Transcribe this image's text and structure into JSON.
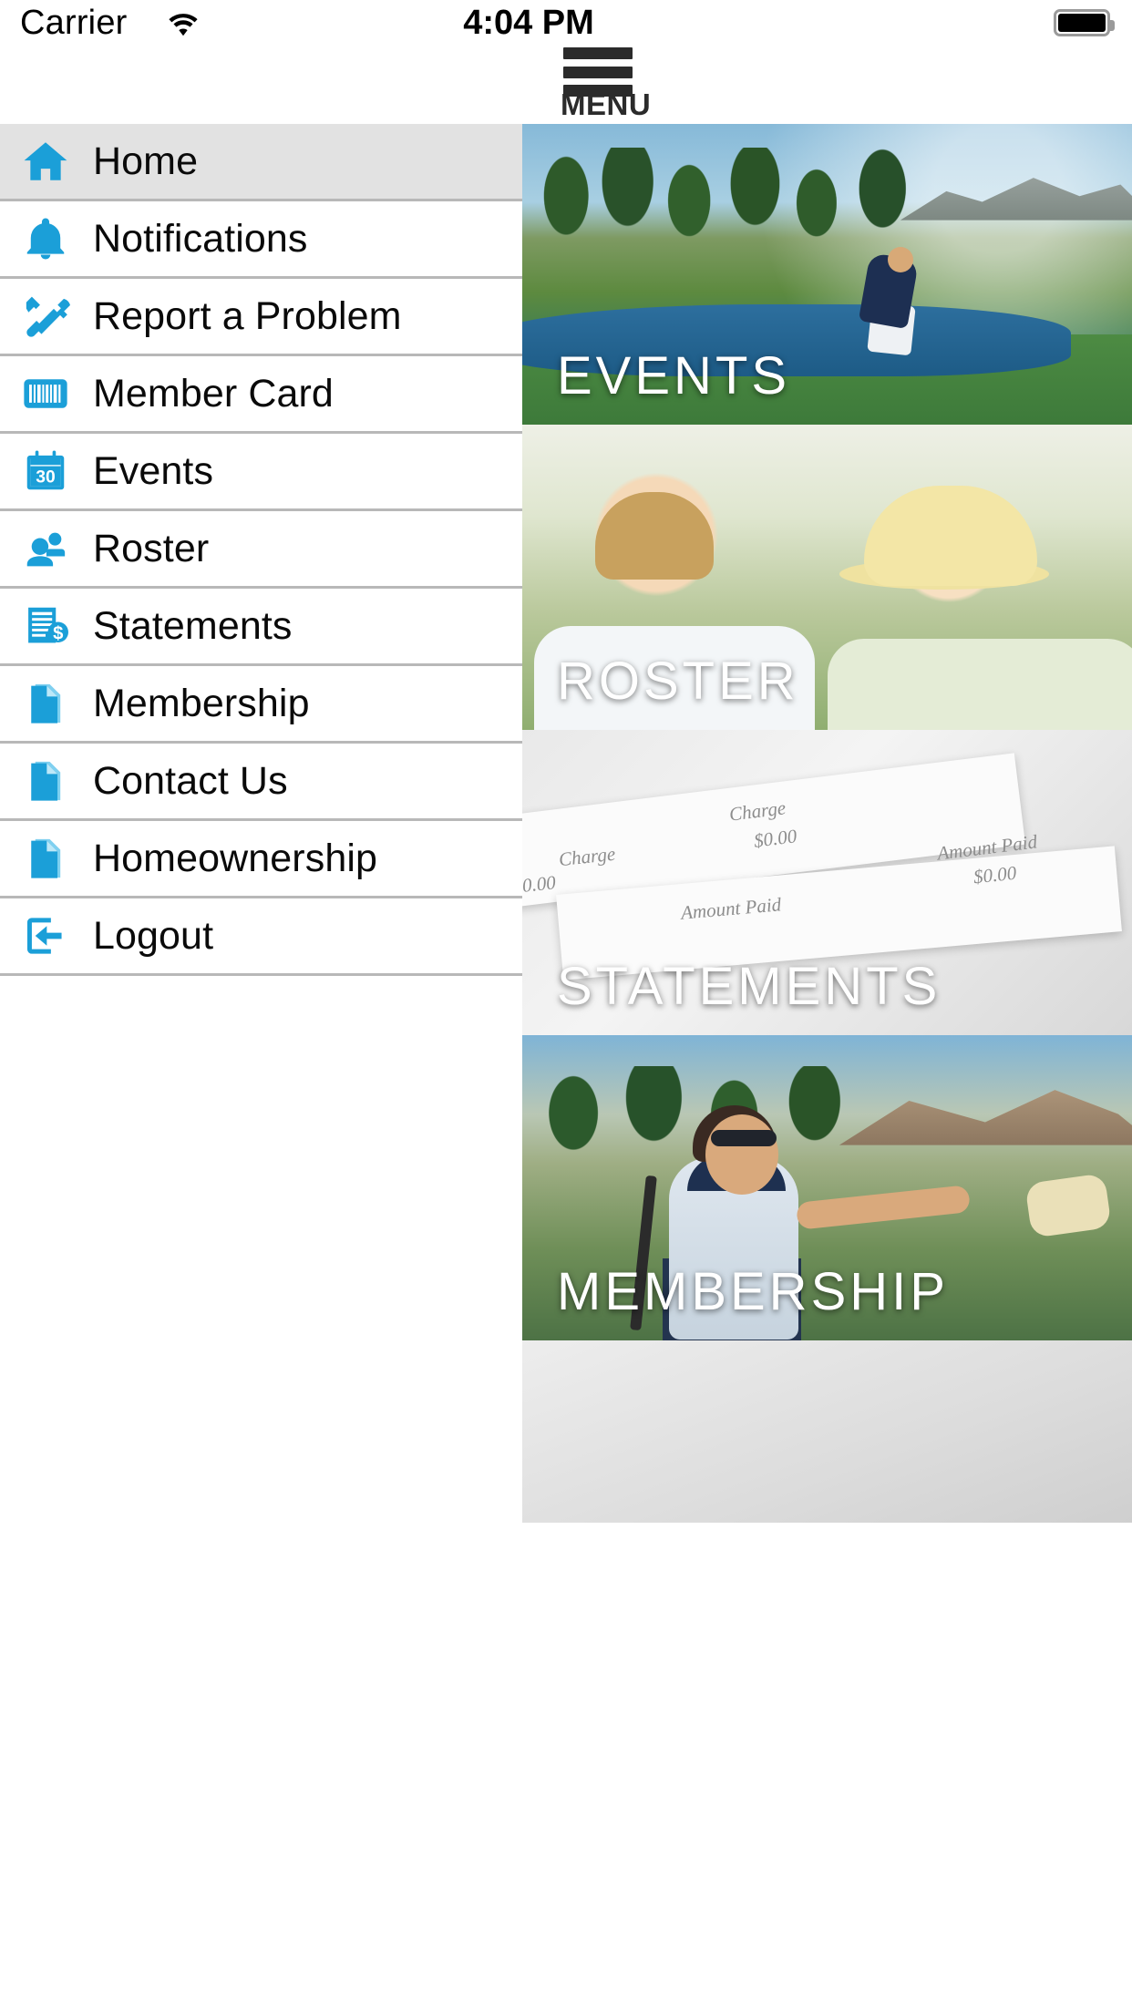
{
  "status_bar": {
    "carrier": "Carrier",
    "wifi_icon": "wifi-icon",
    "time": "4:04 PM",
    "battery_icon": "battery-full-icon"
  },
  "topbar": {
    "menu_button_icon": "hamburger-menu-icon",
    "menu_label": "MENU"
  },
  "accent_color": "#1b9fd8",
  "active_row_color": "#e2e2e2",
  "divider_color": "#b8b8b8",
  "sidebar": {
    "items": [
      {
        "label": "Home",
        "icon": "home-icon",
        "active": true
      },
      {
        "label": "Notifications",
        "icon": "bell-icon",
        "active": false
      },
      {
        "label": "Report a Problem",
        "icon": "tools-icon",
        "active": false
      },
      {
        "label": "Member Card",
        "icon": "barcode-icon",
        "active": false
      },
      {
        "label": "Events",
        "icon": "calendar-30-icon",
        "active": false
      },
      {
        "label": "Roster",
        "icon": "people-icon",
        "active": false
      },
      {
        "label": "Statements",
        "icon": "invoice-dollar-icon",
        "active": false
      },
      {
        "label": "Membership",
        "icon": "document-icon",
        "active": false
      },
      {
        "label": "Contact Us",
        "icon": "document-icon",
        "active": false
      },
      {
        "label": "Homeownership",
        "icon": "document-icon",
        "active": false
      },
      {
        "label": "Logout",
        "icon": "logout-arrow-icon",
        "active": false
      }
    ]
  },
  "tiles": [
    {
      "caption": "EVENTS",
      "scene": "golf-course-photo"
    },
    {
      "caption": "ROSTER",
      "scene": "couple-portrait-photo"
    },
    {
      "caption": "STATEMENTS",
      "scene": "statement-papers-photo",
      "paper_text": [
        "Charge",
        "$0.00",
        "Amount Paid",
        "Charge",
        "$0.00",
        "Amount Paid",
        "0.00"
      ]
    },
    {
      "caption": "MEMBERSHIP",
      "scene": "woman-golfer-photo"
    },
    {
      "caption": "",
      "scene": "blank-photo"
    }
  ]
}
